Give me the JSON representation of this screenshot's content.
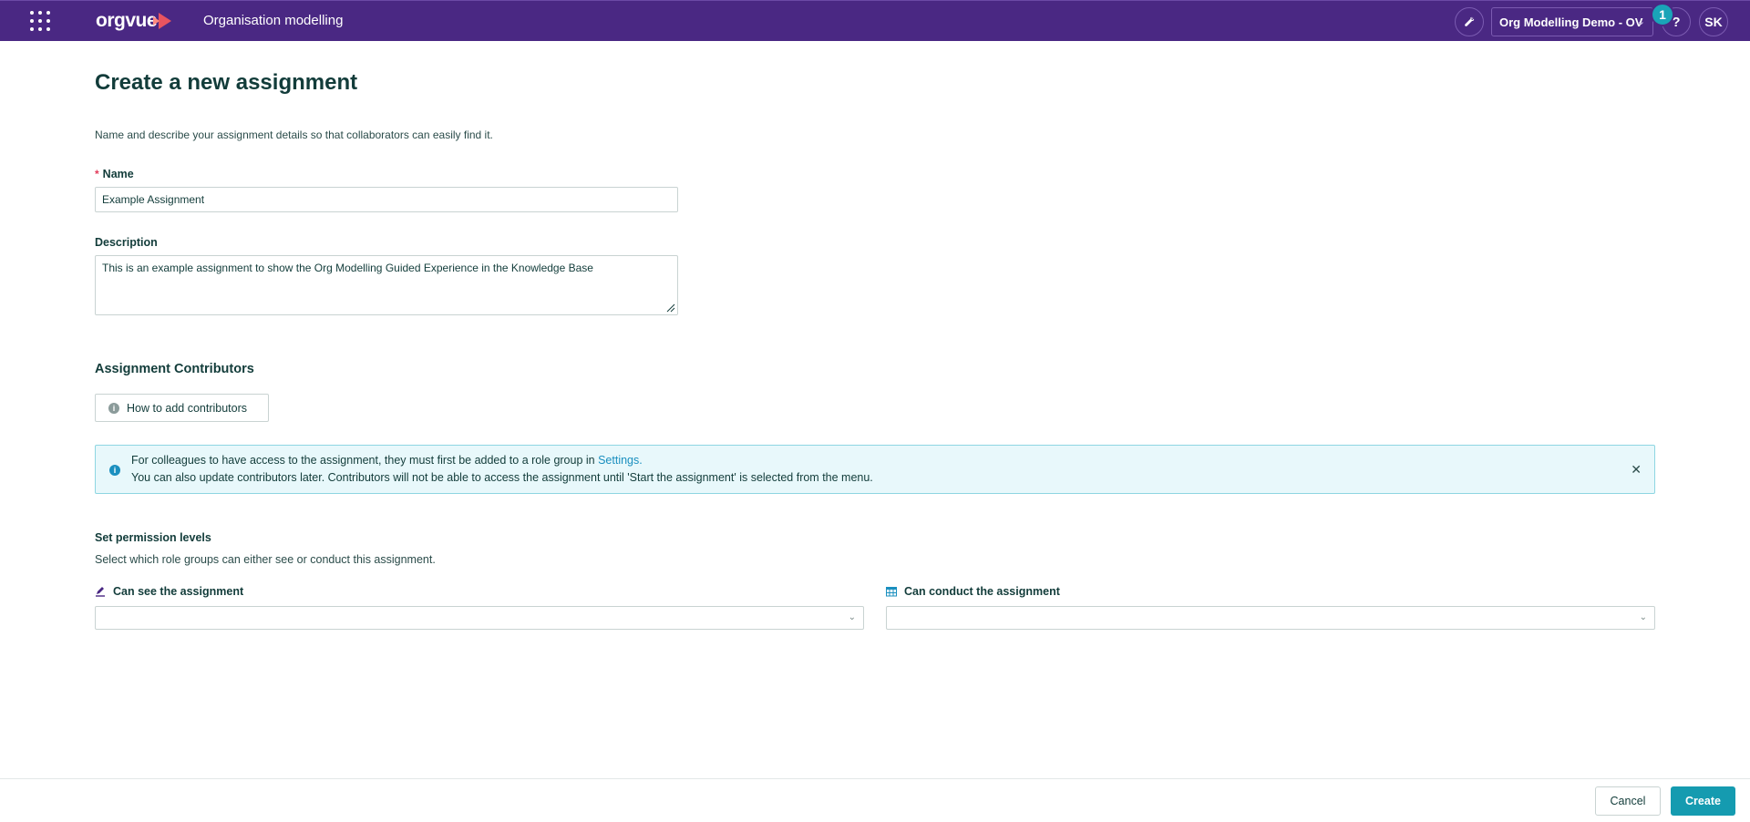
{
  "header": {
    "logo_text": "orgvue",
    "app_title": "Organisation modelling",
    "workspace": "Org Modelling Demo - OV",
    "notification_count": "1",
    "help_label": "?",
    "avatar_initials": "SK"
  },
  "main": {
    "title": "Create a new assignment",
    "intro": "Name and describe your assignment details so that collaborators can easily find it.",
    "name_label": "Name",
    "name_required_mark": "*",
    "name_value": "Example Assignment",
    "description_label": "Description",
    "description_value": "This is an example assignment to show the Org Modelling Guided Experience in the Knowledge Base",
    "contributors_title": "Assignment Contributors",
    "howto_button": "How to add contributors",
    "alert": {
      "line1_text": "For colleagues to have access to the assignment, they must first be added to a role group in ",
      "line1_link": "Settings.",
      "line2_text": "You can also update contributors later. Contributors will not be able to access the assignment until 'Start the assignment' is selected from the menu."
    },
    "permissions": {
      "title": "Set permission levels",
      "subtitle": "Select which role groups can either see or conduct this assignment.",
      "see": {
        "prefix": "Can ",
        "bold": "see",
        "suffix": " the assignment",
        "value": ""
      },
      "conduct": {
        "prefix": "Can ",
        "bold": "conduct",
        "suffix": " the assignment",
        "value": ""
      }
    }
  },
  "footer": {
    "cancel_label": "Cancel",
    "create_label": "Create"
  },
  "colors": {
    "topbar": "#4a2883",
    "accent": "#159bb0",
    "badge": "#1aa4b8",
    "alert_bg": "#e8f8fb",
    "link": "#1a8fbf",
    "required": "#e23a5a"
  },
  "icons": {
    "apps": "grid-dots-icon",
    "tools": "wrench-icon",
    "info": "info-icon",
    "close": "close-icon",
    "see": "eye-pen-icon",
    "conduct": "table-icon",
    "chevron": "chevron-down-icon"
  }
}
